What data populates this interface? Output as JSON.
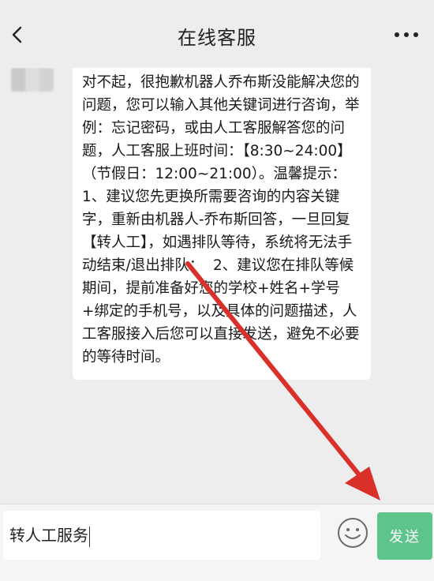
{
  "header": {
    "title": "在线客服",
    "back_icon": "chevron-left-icon",
    "more_icon": "more-horizontal-icon"
  },
  "chat": {
    "messages": [
      {
        "from": "agent",
        "text": "对不起，很抱歉机器人乔布斯没能解决您的问题，您可以输入其他关键词进行咨询，举例：忘记密码，或由人工客服解答您的问题，人工客服上班时间：【8:30~24:00】（节假日：12:00~21:00）。温馨提示：1、建议您先更换所需要咨询的内容关键字，重新由机器人-乔布斯回答，一旦回复【转人工】，如遇排队等待，系统将无法手动结束/退出排队；  2、建议您在排队等候期间，提前准备好您的学校+姓名+学号+绑定的手机号，以及具体的问题描述，人工客服接入后您可以直接发送，避免不必要的等待时间。"
      }
    ]
  },
  "composer": {
    "input_value": "转人工服务",
    "emoji_icon": "emoji-smile-icon",
    "send_label": "发送"
  },
  "colors": {
    "background": "#ededed",
    "bubble": "#ffffff",
    "send_button": "#5dc58b",
    "annotation_arrow": "#d9302a"
  }
}
